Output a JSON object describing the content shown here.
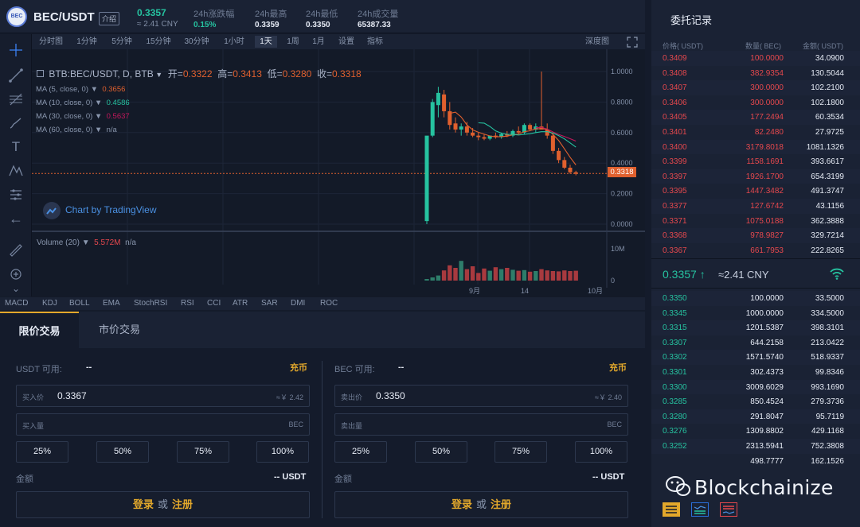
{
  "header": {
    "pair": "BEC/USDT",
    "intro_label": "介绍",
    "logo_text": "BEC",
    "last_price": "0.3357",
    "last_price_cny": "≈ 2.41 CNY",
    "stats": [
      {
        "label": "24h涨跌幅",
        "value": "0.15%",
        "color": "#26c3a0"
      },
      {
        "label": "24h最高",
        "value": "0.3359",
        "color": "#e6ebf5"
      },
      {
        "label": "24h最低",
        "value": "0.3350",
        "color": "#e6ebf5"
      },
      {
        "label": "24h成交量",
        "value": "65387.33",
        "color": "#e6ebf5"
      }
    ]
  },
  "toolbar": {
    "timeframes": [
      "分时图",
      "1分钟",
      "5分钟",
      "15分钟",
      "30分钟",
      "1小时",
      "1天",
      "1周",
      "1月",
      "设置",
      "指标"
    ],
    "active_timeframe": "1天",
    "depth_label": "深度图"
  },
  "chart": {
    "legend_title": "BTB:BEC/USDT, D, BTB",
    "ohlc": {
      "open_label": "开=",
      "open": "0.3322",
      "high_label": "高=",
      "high": "0.3413",
      "low_label": "低=",
      "low": "0.3280",
      "close_label": "收=",
      "close": "0.3318"
    },
    "ma": [
      {
        "label": "MA (5, close, 0)",
        "value": "0.3656",
        "color": "#e0602e"
      },
      {
        "label": "MA (10, close, 0)",
        "value": "0.4586",
        "color": "#26c3a0"
      },
      {
        "label": "MA (30, close, 0)",
        "value": "0.5637",
        "color": "#c2185b"
      },
      {
        "label": "MA (60, close, 0)",
        "value": "n/a",
        "color": "#8a97ae"
      }
    ],
    "attribution": "Chart by TradingView",
    "volume_label": "Volume (20)",
    "volume_value": "5.572M",
    "volume_ma": "n/a",
    "price_ticks": [
      "1.0000",
      "0.8000",
      "0.6000",
      "0.4000",
      "0.2000",
      "0.0000"
    ],
    "current_price_tag": "0.3318",
    "volume_ticks": [
      "10M",
      "0"
    ],
    "x_ticks": [
      "9月",
      "14",
      "10月"
    ],
    "indicators": [
      "MACD",
      "KDJ",
      "BOLL",
      "EMA",
      "StochRSI",
      "RSI",
      "CCI",
      "ATR",
      "SAR",
      "DMI",
      "ROC"
    ]
  },
  "chart_data": {
    "type": "candlestick",
    "price_axis": [
      0,
      1.0
    ],
    "candles": [
      {
        "o": 0.02,
        "h": 0.02,
        "l": 0.0,
        "c": 0.58,
        "up": true
      },
      {
        "o": 0.58,
        "h": 0.82,
        "l": 0.57,
        "c": 0.8,
        "up": true
      },
      {
        "o": 0.78,
        "h": 0.9,
        "l": 0.7,
        "c": 0.86,
        "up": true
      },
      {
        "o": 0.85,
        "h": 0.88,
        "l": 0.7,
        "c": 0.74,
        "up": false
      },
      {
        "o": 0.74,
        "h": 0.8,
        "l": 0.62,
        "c": 0.65,
        "up": false
      },
      {
        "o": 0.66,
        "h": 0.7,
        "l": 0.6,
        "c": 0.62,
        "up": false
      },
      {
        "o": 0.62,
        "h": 0.66,
        "l": 0.58,
        "c": 0.64,
        "up": true
      },
      {
        "o": 0.64,
        "h": 0.67,
        "l": 0.58,
        "c": 0.6,
        "up": false
      },
      {
        "o": 0.6,
        "h": 0.63,
        "l": 0.57,
        "c": 0.58,
        "up": false
      },
      {
        "o": 0.58,
        "h": 0.6,
        "l": 0.55,
        "c": 0.57,
        "up": false
      },
      {
        "o": 0.57,
        "h": 0.59,
        "l": 0.55,
        "c": 0.56,
        "up": false
      },
      {
        "o": 0.56,
        "h": 0.58,
        "l": 0.55,
        "c": 0.58,
        "up": true
      },
      {
        "o": 0.58,
        "h": 0.6,
        "l": 0.56,
        "c": 0.57,
        "up": false
      },
      {
        "o": 0.57,
        "h": 0.6,
        "l": 0.56,
        "c": 0.59,
        "up": true
      },
      {
        "o": 0.59,
        "h": 0.61,
        "l": 0.57,
        "c": 0.58,
        "up": false
      },
      {
        "o": 0.58,
        "h": 0.62,
        "l": 0.57,
        "c": 0.61,
        "up": true
      },
      {
        "o": 0.61,
        "h": 0.64,
        "l": 0.59,
        "c": 0.6,
        "up": false
      },
      {
        "o": 0.6,
        "h": 0.66,
        "l": 0.59,
        "c": 0.65,
        "up": true
      },
      {
        "o": 0.65,
        "h": 0.66,
        "l": 0.61,
        "c": 0.62,
        "up": false
      },
      {
        "o": 0.62,
        "h": 0.66,
        "l": 0.6,
        "c": 0.64,
        "up": true
      },
      {
        "o": 0.64,
        "h": 1.0,
        "l": 0.62,
        "c": 0.62,
        "up": false
      },
      {
        "o": 0.62,
        "h": 0.66,
        "l": 0.56,
        "c": 0.58,
        "up": false
      },
      {
        "o": 0.58,
        "h": 0.6,
        "l": 0.46,
        "c": 0.48,
        "up": false
      },
      {
        "o": 0.48,
        "h": 0.5,
        "l": 0.4,
        "c": 0.42,
        "up": false
      },
      {
        "o": 0.42,
        "h": 0.44,
        "l": 0.36,
        "c": 0.37,
        "up": false
      },
      {
        "o": 0.37,
        "h": 0.39,
        "l": 0.33,
        "c": 0.34,
        "up": false
      },
      {
        "o": 0.34,
        "h": 0.35,
        "l": 0.32,
        "c": 0.33,
        "up": false
      }
    ],
    "volumes": [
      0.5,
      1.0,
      1.6,
      3.2,
      4.8,
      4.0,
      6.2,
      3.6,
      4.5,
      2.4,
      3.8,
      3.1,
      4.2,
      3.6,
      4.0,
      3.4,
      3.1,
      3.3,
      2.8,
      3.0,
      3.6,
      3.2,
      3.0,
      2.9,
      3.2,
      3.0,
      3.1
    ],
    "volume_axis": [
      0,
      10
    ]
  },
  "trade": {
    "tabs": [
      "限价交易",
      "市价交易"
    ],
    "buy": {
      "avail_label": "USDT  可用:",
      "avail_value": "--",
      "deposit": "充币",
      "price_label": "买入价",
      "price_value": "0.3367",
      "price_cny": "≈￥ 2.42",
      "qty_label": "买入量",
      "qty_unit": "BEC",
      "pcts": [
        "25%",
        "50%",
        "75%",
        "100%"
      ],
      "amount_label": "金额",
      "amount_value": "-- USDT",
      "login": "登录",
      "or": "或",
      "register": "注册"
    },
    "sell": {
      "avail_label": "BEC  可用:",
      "avail_value": "--",
      "deposit": "充币",
      "price_label": "卖出价",
      "price_value": "0.3350",
      "price_cny": "≈￥ 2.40",
      "qty_label": "卖出量",
      "qty_unit": "BEC",
      "pcts": [
        "25%",
        "50%",
        "75%",
        "100%"
      ],
      "amount_label": "金额",
      "amount_value": "-- USDT",
      "login": "登录",
      "or": "或",
      "register": "注册"
    }
  },
  "book": {
    "title": "委托记录",
    "headers": [
      "价格( USDT)",
      "数量( BEC)",
      "金额( USDT)"
    ],
    "asks": [
      [
        "0.3409",
        "100.0000",
        "34.0900"
      ],
      [
        "0.3408",
        "382.9354",
        "130.5044"
      ],
      [
        "0.3407",
        "300.0000",
        "102.2100"
      ],
      [
        "0.3406",
        "300.0000",
        "102.1800"
      ],
      [
        "0.3405",
        "177.2494",
        "60.3534"
      ],
      [
        "0.3401",
        "82.2480",
        "27.9725"
      ],
      [
        "0.3400",
        "3179.8018",
        "1081.1326"
      ],
      [
        "0.3399",
        "1158.1691",
        "393.6617"
      ],
      [
        "0.3397",
        "1926.1700",
        "654.3199"
      ],
      [
        "0.3395",
        "1447.3482",
        "491.3747"
      ],
      [
        "0.3377",
        "127.6742",
        "43.1156"
      ],
      [
        "0.3371",
        "1075.0188",
        "362.3888"
      ],
      [
        "0.3368",
        "978.9827",
        "329.7214"
      ],
      [
        "0.3367",
        "661.7953",
        "222.8265"
      ]
    ],
    "mid_price": "0.3357 ↑",
    "mid_cny": "≈2.41 CNY",
    "bids": [
      [
        "0.3350",
        "100.0000",
        "33.5000"
      ],
      [
        "0.3345",
        "1000.0000",
        "334.5000"
      ],
      [
        "0.3315",
        "1201.5387",
        "398.3101"
      ],
      [
        "0.3307",
        "644.2158",
        "213.0422"
      ],
      [
        "0.3302",
        "1571.5740",
        "518.9337"
      ],
      [
        "0.3301",
        "302.4373",
        "99.8346"
      ],
      [
        "0.3300",
        "3009.6029",
        "993.1690"
      ],
      [
        "0.3285",
        "850.4524",
        "279.3736"
      ],
      [
        "0.3280",
        "291.8047",
        "95.7119"
      ],
      [
        "0.3276",
        "1309.8802",
        "429.1168"
      ],
      [
        "0.3252",
        "2313.5941",
        "752.3808"
      ],
      [
        "",
        "498.7777",
        "162.1526"
      ]
    ]
  },
  "watermark": "Blockchainize",
  "colors": {
    "up": "#26c3a0",
    "down": "#e5484d",
    "accent": "#e3a82b",
    "bg": "#141b2b"
  }
}
